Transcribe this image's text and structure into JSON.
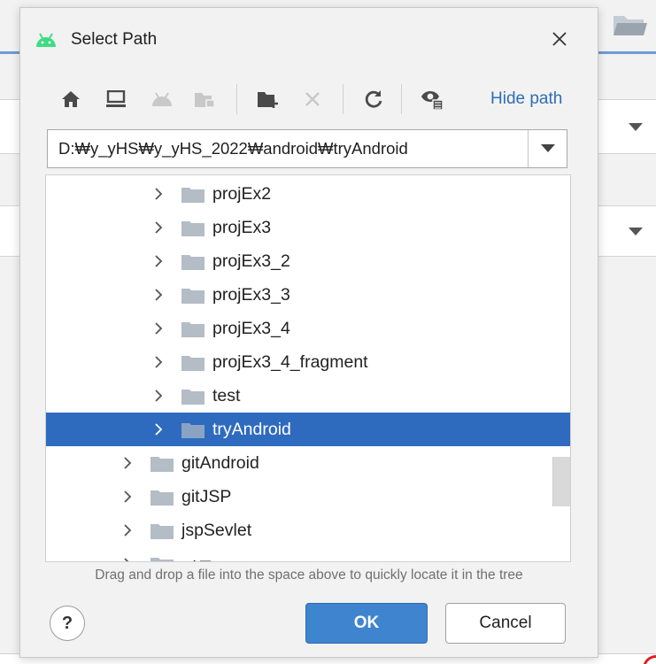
{
  "dialog": {
    "title": "Select Path",
    "icon": "android-icon",
    "close_icon": "close-icon"
  },
  "toolbar": {
    "icons": [
      "home-icon",
      "desktop-icon",
      "android-project-icon",
      "module-icon",
      "new-folder-icon",
      "delete-icon",
      "refresh-icon",
      "show-hidden-icon"
    ],
    "hide_path_label": "Hide path"
  },
  "path": {
    "value": "D:₩y_yHS₩y_yHS_2022₩android₩tryAndroid"
  },
  "tree": {
    "items": [
      {
        "label": "projEx2",
        "level": 2,
        "selected": false
      },
      {
        "label": "projEx3",
        "level": 2,
        "selected": false
      },
      {
        "label": "projEx3_2",
        "level": 2,
        "selected": false
      },
      {
        "label": "projEx3_3",
        "level": 2,
        "selected": false
      },
      {
        "label": "projEx3_4",
        "level": 2,
        "selected": false
      },
      {
        "label": "projEx3_4_fragment",
        "level": 2,
        "selected": false
      },
      {
        "label": "test",
        "level": 2,
        "selected": false
      },
      {
        "label": "tryAndroid",
        "level": 2,
        "selected": true
      },
      {
        "label": "gitAndroid",
        "level": 1,
        "selected": false
      },
      {
        "label": "gitJSP",
        "level": 1,
        "selected": false
      },
      {
        "label": "jspSevlet",
        "level": 1,
        "selected": false
      },
      {
        "label": "서류",
        "level": 1,
        "selected": false
      }
    ]
  },
  "hint": "Drag and drop a file into the space above to quickly locate it in the tree",
  "buttons": {
    "help_label": "?",
    "ok_label": "OK",
    "cancel_label": "Cancel"
  },
  "colors": {
    "accent": "#2e6bbf",
    "ok_button": "#3f84cf",
    "link": "#2f6db5",
    "folder": "#b4bcc6",
    "android_green": "#3ddc84"
  }
}
